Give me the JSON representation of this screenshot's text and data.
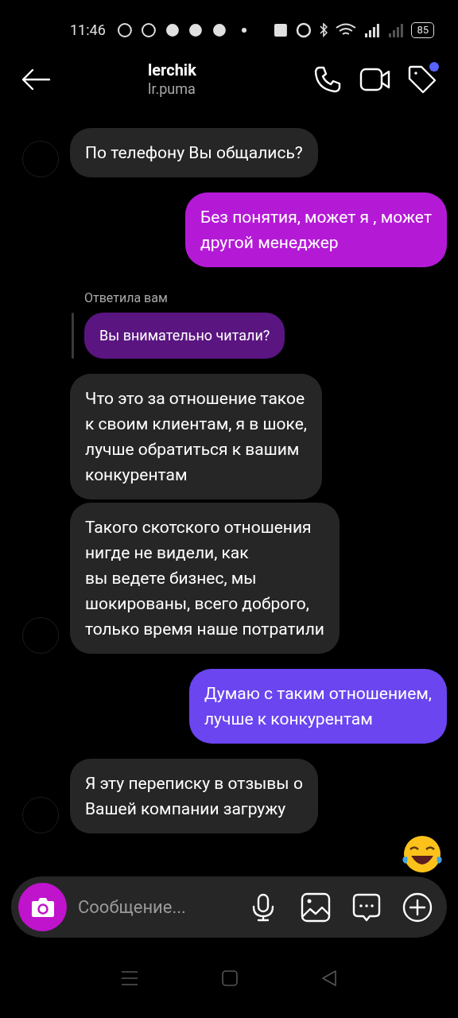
{
  "status_bar": {
    "time": "11:46",
    "battery": "85"
  },
  "header": {
    "name": "lerchik",
    "username": "lr.puma",
    "has_notification": true
  },
  "messages": [
    {
      "kind": "incoming",
      "text": "По телефону Вы общались?",
      "avatar": true
    },
    {
      "kind": "outgoing",
      "text": "Без понятия, может я , может\nдругой менеджер",
      "color": "#b41ad6"
    },
    {
      "kind": "reply",
      "label": "Ответила вам",
      "text": "Вы внимательно читали?",
      "color": "#5a1580"
    },
    {
      "kind": "incoming",
      "text": "Что это за отношение такое\nк своим клиентам, я в шоке,\nлучше обратиться к вашим\nконкурентам",
      "avatar": false
    },
    {
      "kind": "incoming",
      "text": "Такого скотского отношения\nнигде не видели, как\nвы ведете бизнес, мы\nшокированы, всего доброго,\nтолько время наше потратили",
      "avatar": true
    },
    {
      "kind": "outgoing",
      "text": "Думаю с таким отношением,\nлучше к конкурентам",
      "color": "#6a45f0"
    },
    {
      "kind": "incoming",
      "text": "Я эту переписку в отзывы о\nВашей компании загружу",
      "avatar": true
    }
  ],
  "composer": {
    "placeholder": "Сообщение..."
  }
}
